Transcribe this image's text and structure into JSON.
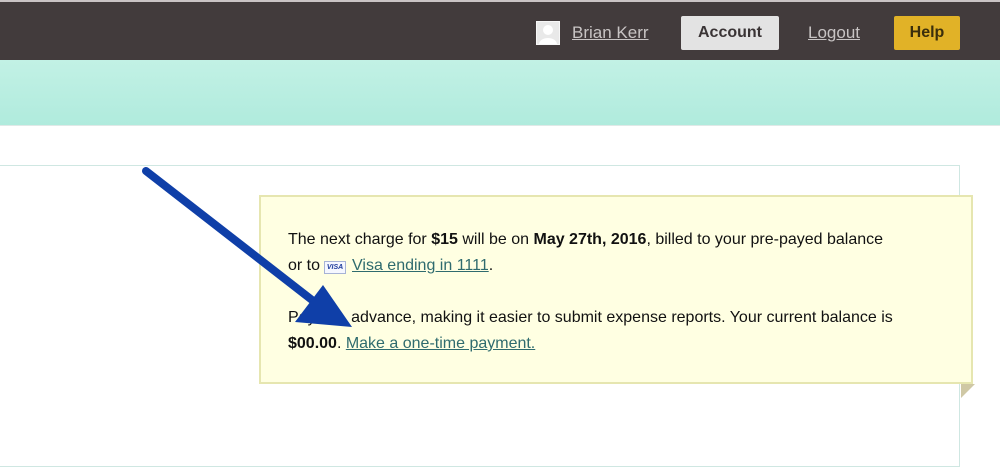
{
  "header": {
    "user_name": "Brian Kerr",
    "account_label": "Account",
    "logout_label": "Logout",
    "help_label": "Help"
  },
  "billing_note": {
    "charge_prefix": "The next charge for ",
    "charge_amount": "$15",
    "charge_middle": " will be on ",
    "charge_date": "May 27th, 2016",
    "charge_suffix": ", billed to your pre-payed balance",
    "card_prefix": "or to",
    "card_brand": "VISA",
    "card_link": "Visa ending in 1111",
    "card_suffix": ".",
    "balance_start": "Pay",
    "balance_text": "advance, making it easier to submit expense reports. Your current balance is",
    "balance_amount": "$00.00",
    "balance_after": ". ",
    "payment_link": "Make a one-time payment."
  },
  "colors": {
    "topbar": "#423b3c",
    "band": "#b8eee1",
    "note_background": "#ffffe2",
    "link": "#2f6b6e",
    "help_button": "#e1b227",
    "annotation_arrow": "#0f3fa8"
  },
  "icons": [
    "user-avatar-icon",
    "visa-card-icon",
    "annotation-arrow"
  ]
}
